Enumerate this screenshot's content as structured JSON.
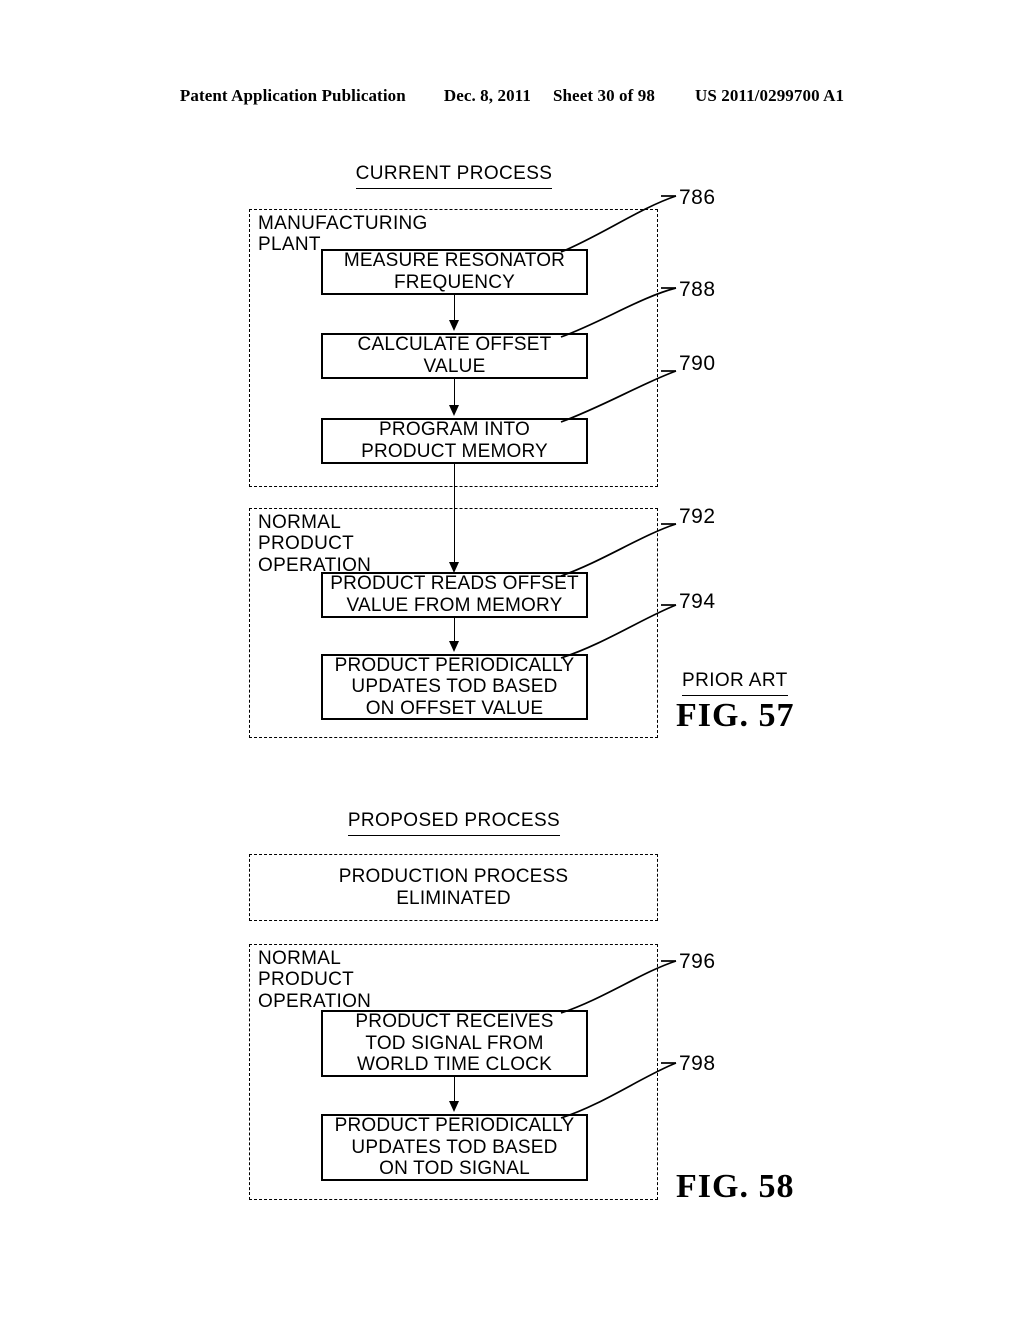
{
  "header": {
    "publication": "Patent Application Publication",
    "date": "Dec. 8, 2011",
    "sheet": "Sheet 30 of 98",
    "patent_number": "US 2011/0299700 A1"
  },
  "figures": [
    {
      "id": "fig-57",
      "title": "CURRENT PROCESS",
      "prior_art_label": "PRIOR ART",
      "caption": "FIG.  57",
      "regions": [
        {
          "name": "manufacturing-plant",
          "label": "MANUFACTURING PLANT",
          "steps": [
            {
              "ref": "786",
              "text": "MEASURE RESONATOR\nFREQUENCY"
            },
            {
              "ref": "788",
              "text": "CALCULATE OFFSET\nVALUE"
            },
            {
              "ref": "790",
              "text": "PROGRAM INTO\nPRODUCT MEMORY"
            }
          ]
        },
        {
          "name": "normal-product-operation",
          "label": "NORMAL PRODUCT\n   OPERATION",
          "steps": [
            {
              "ref": "792",
              "text": "PRODUCT READS OFFSET\nVALUE FROM MEMORY"
            },
            {
              "ref": "794",
              "text": "PRODUCT PERIODICALLY\nUPDATES TOD BASED\nON OFFSET VALUE"
            }
          ]
        }
      ]
    },
    {
      "id": "fig-58",
      "title": "PROPOSED PROCESS",
      "caption": "FIG.  58",
      "regions": [
        {
          "name": "production-process-eliminated",
          "label": "",
          "body_text": "PRODUCTION PROCESS\nELIMINATED",
          "steps": []
        },
        {
          "name": "normal-product-operation",
          "label": "NORMAL PRODUCT\n   OPERATION",
          "steps": [
            {
              "ref": "796",
              "text": "PRODUCT RECEIVES\nTOD SIGNAL FROM\nWORLD TIME CLOCK"
            },
            {
              "ref": "798",
              "text": "PRODUCT PERIODICALLY\nUPDATES TOD BASED\nON TOD SIGNAL"
            }
          ]
        }
      ]
    }
  ],
  "colors": {
    "ink": "#000000",
    "paper": "#ffffff"
  }
}
